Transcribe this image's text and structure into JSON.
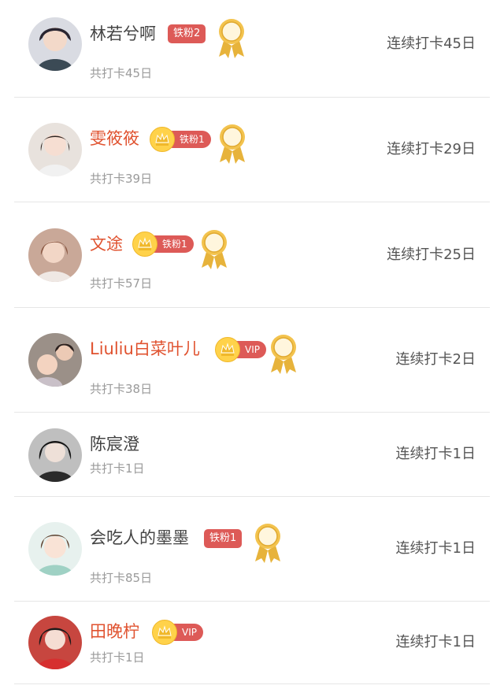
{
  "items": [
    {
      "name": "林若兮啊",
      "sub": "共打卡45日",
      "streak": "连续打卡45日",
      "badge": "铁粉2",
      "medal": "lv2"
    },
    {
      "name": "雯筱筱",
      "sub": "共打卡39日",
      "streak": "连续打卡29日",
      "badge": "铁粉1",
      "medal": "lv2"
    },
    {
      "name": "文途",
      "sub": "共打卡57日",
      "streak": "连续打卡25日",
      "badge": "铁粉1",
      "medal": "lv2"
    },
    {
      "name": "Liuliu白菜叶儿",
      "sub": "共打卡38日",
      "streak": "连续打卡2日",
      "badge": "VIP",
      "medal": "lv2"
    },
    {
      "name": "陈宸澄",
      "sub": "共打卡1日",
      "streak": "连续打卡1日"
    },
    {
      "name": "会吃人的墨墨",
      "sub": "共打卡85日",
      "streak": "连续打卡1日",
      "badge": "铁粉1",
      "medal": "lv2"
    },
    {
      "name": "田晚柠",
      "sub": "共打卡1日",
      "streak": "连续打卡1日",
      "badge": "VIP"
    }
  ],
  "colors": {
    "accent": "#e0522f",
    "badge_bg": "#dd5a57",
    "crown": "#ffd24a",
    "medal_gold": "#e7b33b"
  },
  "icons": {
    "crown": "crown-icon",
    "medal": "award-medal-icon",
    "avatar": "user-avatar"
  }
}
